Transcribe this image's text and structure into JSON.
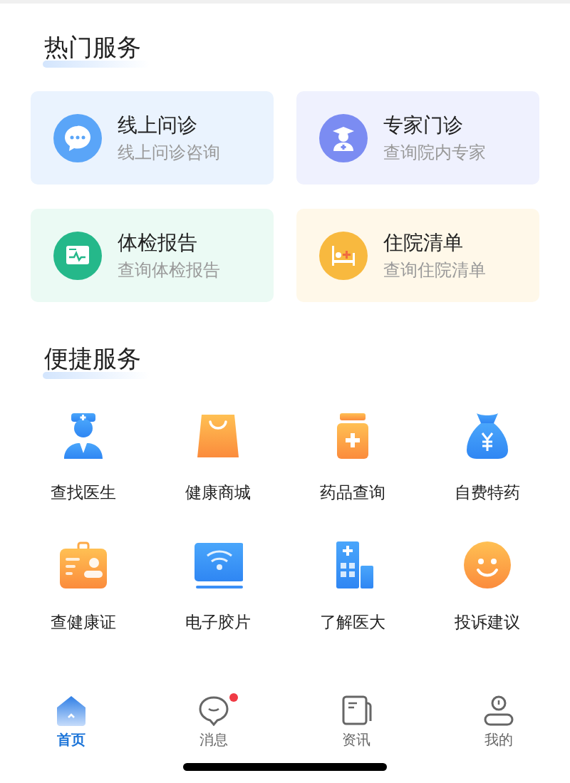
{
  "hot_services": {
    "title": "热门服务",
    "cards": [
      {
        "kind": "chat",
        "title": "线上问诊",
        "subtitle": "线上问诊咨询",
        "color": "#eaf3fe"
      },
      {
        "kind": "expert",
        "title": "专家门诊",
        "subtitle": "查询院内专家",
        "color": "#eff1fe"
      },
      {
        "kind": "report",
        "title": "体检报告",
        "subtitle": "查询体检报告",
        "color": "#ebfaf4"
      },
      {
        "kind": "bed",
        "title": "住院清单",
        "subtitle": "查询住院清单",
        "color": "#fff8e9"
      }
    ]
  },
  "quick_services": {
    "title": "便捷服务",
    "items": [
      {
        "kind": "doctor",
        "label": "查找医生"
      },
      {
        "kind": "bag",
        "label": "健康商城"
      },
      {
        "kind": "medicine",
        "label": "药品查询"
      },
      {
        "kind": "moneybag",
        "label": "自费特药"
      },
      {
        "kind": "idcard",
        "label": "查健康证"
      },
      {
        "kind": "film",
        "label": "电子胶片"
      },
      {
        "kind": "hospital",
        "label": "了解医大"
      },
      {
        "kind": "smile",
        "label": "投诉建议"
      }
    ]
  },
  "tab_bar": [
    {
      "kind": "home",
      "label": "首页",
      "selected": true,
      "badge": false
    },
    {
      "kind": "message",
      "label": "消息",
      "selected": false,
      "badge": true
    },
    {
      "kind": "news",
      "label": "资讯",
      "selected": false,
      "badge": false
    },
    {
      "kind": "profile",
      "label": "我的",
      "selected": false,
      "badge": false
    }
  ]
}
